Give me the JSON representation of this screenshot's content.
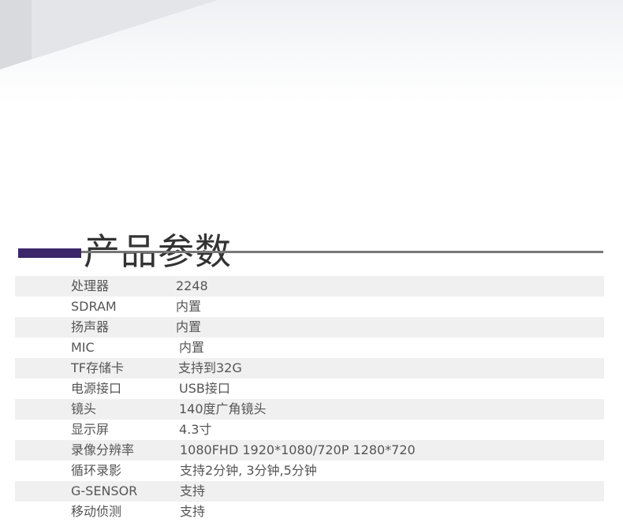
{
  "page": {
    "section_title": "产品参数",
    "accent_color": "#3b2669"
  },
  "specs": [
    {
      "label": "处理器",
      "value": "2248"
    },
    {
      "label": "SDRAM",
      "value": "内置"
    },
    {
      "label": "扬声器",
      "value": "内置"
    },
    {
      "label": "MIC",
      "value": "内置"
    },
    {
      "label": "TF存储卡",
      "value": "支持到32G"
    },
    {
      "label": "电源接口",
      "value": "USB接口"
    },
    {
      "label": "镜头",
      "value": "140度广角镜头"
    },
    {
      "label": "显示屏",
      "value": "4.3寸"
    },
    {
      "label": "录像分辨率",
      "value": "1080FHD 1920*1080/720P 1280*720"
    },
    {
      "label": "循环录影",
      "value": "支持2分钟, 3分钟,5分钟"
    },
    {
      "label": "G-SENSOR",
      "value": "支持"
    },
    {
      "label": "移动侦测",
      "value": "支持"
    }
  ]
}
